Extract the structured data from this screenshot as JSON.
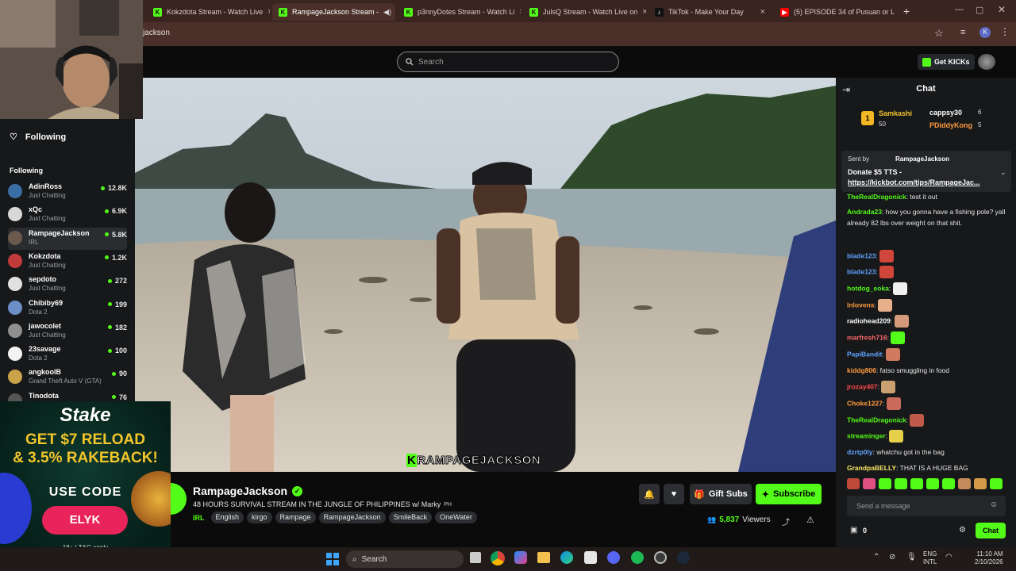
{
  "browser": {
    "tabs": [
      {
        "title": "Kokzdota Stream - Watch Live",
        "favicon": "kick-icon"
      },
      {
        "title": "RampageJackson Stream -",
        "favicon": "kick-icon",
        "active": true
      },
      {
        "title": "p3nnyDotes Stream - Watch Li",
        "favicon": "kick-icon"
      },
      {
        "title": "JulsQ Stream - Watch Live on",
        "favicon": "kick-icon"
      },
      {
        "title": "TikTok - Make Your Day",
        "favicon": "tiktok-icon"
      },
      {
        "title": "(5) EPISODE 34 of Pusuan or L",
        "favicon": "youtube-icon"
      }
    ],
    "new_tab": "+",
    "url": "jackson",
    "profile_initial": "K"
  },
  "header": {
    "search_placeholder": "Search",
    "get_kicks": "Get KICKs"
  },
  "sidebar": {
    "following_heading": "Following",
    "following_label": "Following",
    "channels": [
      {
        "name": "AdinRoss",
        "category": "Just Chatting",
        "viewers": "12.8K",
        "color": "#3b6ea5"
      },
      {
        "name": "xQc",
        "category": "Just Chatting",
        "viewers": "6.9K",
        "color": "#d8d8d8"
      },
      {
        "name": "RampageJackson",
        "category": "IRL",
        "viewers": "5.8K",
        "color": "#6b5a4d"
      },
      {
        "name": "Kokzdota",
        "category": "Just Chatting",
        "viewers": "1.2K",
        "color": "#c23b3b"
      },
      {
        "name": "sepdoto",
        "category": "Just Chatting",
        "viewers": "272",
        "color": "#e0e0e0"
      },
      {
        "name": "Chibiby69",
        "category": "Dota 2",
        "viewers": "199",
        "color": "#6d8fc7"
      },
      {
        "name": "jawocolet",
        "category": "Just Chatting",
        "viewers": "182",
        "color": "#8f8f8f"
      },
      {
        "name": "23savage",
        "category": "Dota 2",
        "viewers": "100",
        "color": "#f2f2f2"
      },
      {
        "name": "angkoolB",
        "category": "Grand Theft Auto V (GTA)",
        "viewers": "90",
        "color": "#c9a24a"
      },
      {
        "name": "Tinodota",
        "category": "",
        "viewers": "76",
        "color": "#555"
      }
    ]
  },
  "ad": {
    "brand": "Stake",
    "headline1": "GET $7 RELOAD",
    "headline2": "& 3.5% RAKEBACK!",
    "use_code": "USE CODE",
    "code": "ELYK",
    "disclaimer": "18+ | T&C apply"
  },
  "video": {
    "overlay_text": "RAMPAGEJACKSON",
    "overlay_k": "K"
  },
  "stream": {
    "streamer": "RampageJackson",
    "title": "48 HOURS SURVIVAL STREAM IN THE JUNGLE OF PHILIPPINES w/ Marky",
    "title_suffix": "PH",
    "category": "IRL",
    "tags": [
      "English",
      "kirgo",
      "Rampage",
      "RampageJackson",
      "SmileBack",
      "OneWater"
    ],
    "viewers": "5,837",
    "viewers_label": "Viewers",
    "gift_subs": "Gift Subs",
    "subscribe": "Subscribe"
  },
  "chat": {
    "title": "Chat",
    "leaderboard": [
      {
        "rank": "1",
        "name": "Samkashi",
        "count": "50"
      },
      {
        "name": "cappsy30",
        "count": "6"
      },
      {
        "name": "PDiddyKong",
        "count": "5"
      }
    ],
    "pinned": {
      "sent_by": "Sent by",
      "sender": "RampageJackson",
      "text": "Donate $5 TTS -",
      "link": "https://kickbot.com/tips/RampageJac..."
    },
    "messages": [
      {
        "user": "TheRealDragonick",
        "color": "#53fc18",
        "text": "test it out"
      },
      {
        "user": "Andrada23",
        "color": "#53fc18",
        "text": "how you gonna have a fishing pole? yall already 82 lbs over weight on that shit."
      },
      {
        "user": "blade123",
        "color": "#5ea4ff",
        "text": ""
      },
      {
        "user": "blade123",
        "color": "#5ea4ff",
        "text": ""
      },
      {
        "user": "hotdog_eoka",
        "color": "#53fc18",
        "text": ""
      },
      {
        "user": "lnlovens",
        "color": "#ff9b3d",
        "text": ""
      },
      {
        "user": "radiohead209",
        "color": "#ffffff",
        "text": ""
      },
      {
        "user": "marfresh716",
        "color": "#ff6a6a",
        "text": ""
      },
      {
        "user": "PapiBandit",
        "color": "#5ea4ff",
        "text": ""
      },
      {
        "user": "kiddg806",
        "color": "#ff9b3d",
        "text": "fatso smuggling in food"
      },
      {
        "user": "jrozay407",
        "color": "#ff4b4b",
        "text": ""
      },
      {
        "user": "Choke1227",
        "color": "#ff9b3d",
        "text": ""
      },
      {
        "user": "TheRealDragonick",
        "color": "#53fc18",
        "text": ""
      },
      {
        "user": "streaminger",
        "color": "#53fc18",
        "text": ""
      },
      {
        "user": "dzrtp0ly",
        "color": "#5ea4ff",
        "text": "whatchu got in the bag"
      },
      {
        "user": "GrandpaBELLY",
        "color": "#f5e663",
        "text": "THAT IS A HUGE BAG"
      }
    ],
    "input_placeholder": "Send a message",
    "points": "0",
    "chat_button": "Chat"
  },
  "taskbar": {
    "search": "Search",
    "lang1": "ENG",
    "lang2": "INTL",
    "time": "11:10 AM",
    "date": "2/10/2026"
  },
  "colors": {
    "kick_green": "#53fc18",
    "background": "#0b0b0c",
    "panel": "#17181a"
  }
}
